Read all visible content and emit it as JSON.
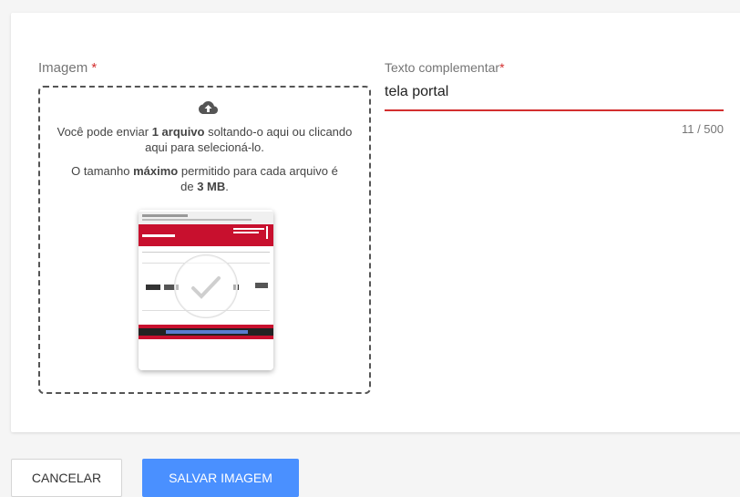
{
  "image_field": {
    "label": "Imagem",
    "required_mark": "*",
    "upload_icon": "cloud-upload-icon",
    "delete_icon": "trash-icon",
    "dropzone": {
      "line1_a": "Você pode enviar ",
      "line1_b": "1 arquivo",
      "line1_c": " soltando-o aqui ou clicando aqui para selecioná-lo.",
      "line2_a": "O tamanho ",
      "line2_b": "máximo",
      "line2_c": " permitido para cada arquivo é de ",
      "line2_d": "3 MB",
      "line2_e": "."
    }
  },
  "text_field": {
    "label": "Texto complementar",
    "required_mark": "*",
    "value": "tela portal",
    "counter": "11 / 500"
  },
  "actions": {
    "cancel_label": "CANCELAR",
    "save_label": "SALVAR IMAGEM"
  },
  "colors": {
    "primary": "#4a90ff",
    "error": "#d32f2f"
  }
}
